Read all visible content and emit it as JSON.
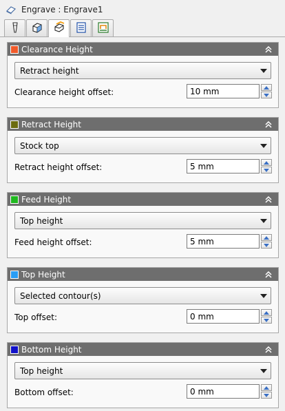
{
  "window": {
    "title": "Engrave : Engrave1"
  },
  "tabs": [
    {
      "icon": "tool-icon",
      "active": false
    },
    {
      "icon": "geometry-icon",
      "active": false
    },
    {
      "icon": "heights-icon",
      "active": true
    },
    {
      "icon": "passes-icon",
      "active": false
    },
    {
      "icon": "linking-icon",
      "active": false
    }
  ],
  "panels": [
    {
      "title": "Clearance Height",
      "color": "#f05a2a",
      "select_value": "Retract height",
      "offset_label": "Clearance height offset:",
      "offset_value": "10 mm"
    },
    {
      "title": "Retract Height",
      "color": "#6b6b10",
      "select_value": "Stock top",
      "offset_label": "Retract height offset:",
      "offset_value": "5 mm"
    },
    {
      "title": "Feed Height",
      "color": "#1fb81f",
      "select_value": "Top height",
      "offset_label": "Feed height offset:",
      "offset_value": "5 mm"
    },
    {
      "title": "Top Height",
      "color": "#2a9df4",
      "select_value": "Selected contour(s)",
      "offset_label": "Top offset:",
      "offset_value": "0 mm"
    },
    {
      "title": "Bottom Height",
      "color": "#1111c8",
      "select_value": "Top height",
      "offset_label": "Bottom offset:",
      "offset_value": "0 mm"
    }
  ]
}
